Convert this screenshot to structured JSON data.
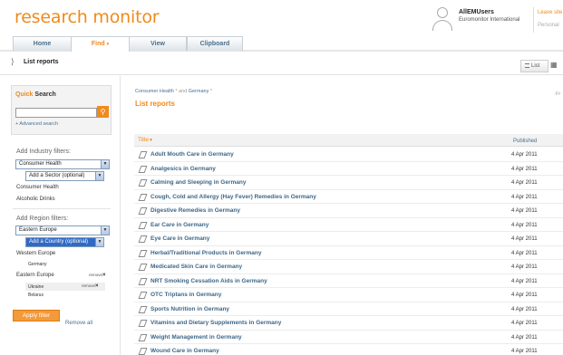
{
  "header": {
    "logo": "research monitor",
    "user_name": "AllEMUsers",
    "user_org": "Euromonitor International",
    "leave_link": "Leave site",
    "personal_link": "Personal"
  },
  "tabs": [
    {
      "label": "Home"
    },
    {
      "label": "Find"
    },
    {
      "label": "View"
    },
    {
      "label": "Clipboard"
    }
  ],
  "find_caret": "▾",
  "breadcrumb": {
    "title": "List reports"
  },
  "view_buttons": {
    "list": "List"
  },
  "quick_search": {
    "title_highlight": "Quick",
    "title_rest": " Search",
    "input_value": "",
    "advanced_link": "+ Advanced search"
  },
  "industry_filters": {
    "label": "Add Industry filters:",
    "selected": "Consumer Health",
    "sector_placeholder": "Add a Sector (optional)",
    "items": [
      "Consumer Health",
      "Alcoholic Drinks"
    ]
  },
  "region_filters": {
    "label": "Add Region filters:",
    "selected": "Eastern Europe",
    "country_placeholder": "Add a Country (optional)",
    "western": "Western Europe",
    "germany": "Germany",
    "eastern": "Eastern Europe",
    "remove": "remove",
    "ukraine": "Ukraine",
    "belarus": "Belarus"
  },
  "apply_label": "Apply filter",
  "remove_all_label": "Remove all",
  "main": {
    "crumb_part1": "Consumer Health",
    "crumb_sep": "and",
    "crumb_part2": "Germany",
    "title": "List reports",
    "fr_text": "Fr",
    "col_title": "Title",
    "col_title_arrow": "▼",
    "col_published": "Published"
  },
  "reports": [
    {
      "title": "Adult Mouth Care in Germany",
      "date": "4 Apr 2011"
    },
    {
      "title": "Analgesics in Germany",
      "date": "4 Apr 2011"
    },
    {
      "title": "Calming and Sleeping in Germany",
      "date": "4 Apr 2011"
    },
    {
      "title": "Cough, Cold and Allergy (Hay Fever) Remedies in Germany",
      "date": "4 Apr 2011"
    },
    {
      "title": "Digestive Remedies in Germany",
      "date": "4 Apr 2011"
    },
    {
      "title": "Ear Care in Germany",
      "date": "4 Apr 2011"
    },
    {
      "title": "Eye Care in Germany",
      "date": "4 Apr 2011"
    },
    {
      "title": "Herbal/Traditional Products in Germany",
      "date": "4 Apr 2011"
    },
    {
      "title": "Medicated Skin Care in Germany",
      "date": "4 Apr 2011"
    },
    {
      "title": "NRT Smoking Cessation Aids in Germany",
      "date": "4 Apr 2011"
    },
    {
      "title": "OTC Triptans in Germany",
      "date": "4 Apr 2011"
    },
    {
      "title": "Sports Nutrition in Germany",
      "date": "4 Apr 2011"
    },
    {
      "title": "Vitamins and Dietary Supplements in Germany",
      "date": "4 Apr 2011"
    },
    {
      "title": "Weight Management in Germany",
      "date": "4 Apr 2011"
    },
    {
      "title": "Wound Care in Germany",
      "date": "4 Apr 2011"
    }
  ]
}
